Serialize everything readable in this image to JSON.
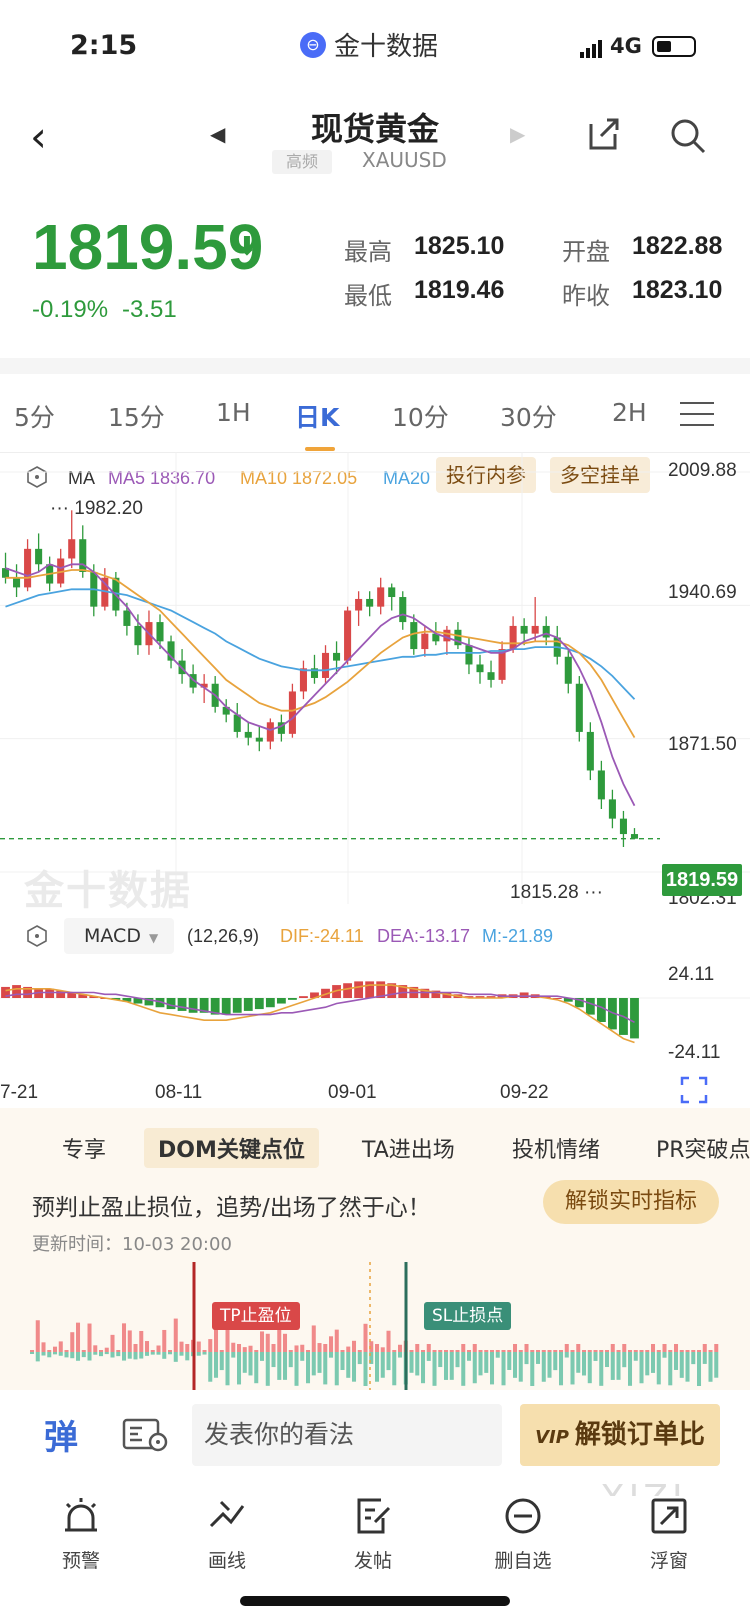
{
  "status": {
    "time": "2:15",
    "app_name": "金十数据",
    "app_logo": "⊖",
    "network": "4G"
  },
  "header": {
    "title": "现货黄金",
    "tag": "高频",
    "ticker": "XAUUSD"
  },
  "quote": {
    "price": "1819.59",
    "change_pct": "-0.19%",
    "change": "-3.51",
    "high_label": "最高",
    "high": "1825.10",
    "open_label": "开盘",
    "open": "1822.88",
    "low_label": "最低",
    "low": "1819.46",
    "prev_label": "昨收",
    "prev": "1823.10",
    "direction": "down",
    "color_down": "#2e9a3c"
  },
  "periods": [
    "5分",
    "15分",
    "1H",
    "日K",
    "10分",
    "30分",
    "2H"
  ],
  "active_period": "日K",
  "ma": {
    "label": "MA",
    "ma5": "MA5 1836.70",
    "ma10": "MA10 1872.05",
    "ma20": "MA20"
  },
  "chips": {
    "a": "投行内参",
    "b": "多空挂单"
  },
  "price_axis": {
    "t1": "2009.88",
    "t2": "1940.69",
    "t3": "1871.50",
    "t4": "1802.31"
  },
  "last_price_tag": "1819.59",
  "annot": {
    "high": "1982.20",
    "low": "1815.28"
  },
  "watermark": "金十数据",
  "macd": {
    "name": "MACD",
    "params": "(12,26,9)",
    "dif": "DIF:-24.11",
    "dea": "DEA:-13.17",
    "m": "M:-21.89",
    "axis_top": "24.11",
    "axis_bottom": "-24.11"
  },
  "dates": [
    "7-21",
    "08-11",
    "09-01",
    "09-22"
  ],
  "strategy_tabs": [
    "专享",
    "DOM关键点位",
    "TA进出场",
    "投机情绪",
    "PR突破点"
  ],
  "strategy": {
    "slogan": "预判止盈止损位，追势/出场了然于心！",
    "unlock": "解锁实时指标",
    "updated": "更新时间：10-03 20:00",
    "tp": "TP止盈位",
    "sl": "SL止损点"
  },
  "input": {
    "qiang": "弹",
    "placeholder": "发表你的看法",
    "vip": "VIP",
    "unlock": "解锁订单比"
  },
  "nav": [
    "预警",
    "画线",
    "发帖",
    "删自选",
    "浮窗"
  ],
  "watermark2": "XIZI",
  "chart_data": {
    "type": "candlestick",
    "title": "现货黄金 XAUUSD 日K",
    "ylim": [
      1802.31,
      2009.88
    ],
    "ticks": [
      "7-21",
      "08-11",
      "09-01",
      "09-22"
    ],
    "ohlc": [
      [
        1960,
        1968,
        1952,
        1955
      ],
      [
        1955,
        1962,
        1945,
        1950
      ],
      [
        1950,
        1975,
        1948,
        1970
      ],
      [
        1970,
        1978,
        1958,
        1962
      ],
      [
        1962,
        1966,
        1948,
        1952
      ],
      [
        1952,
        1970,
        1950,
        1965
      ],
      [
        1965,
        1990,
        1960,
        1975
      ],
      [
        1975,
        1982.2,
        1955,
        1958
      ],
      [
        1958,
        1962,
        1935,
        1940
      ],
      [
        1940,
        1960,
        1938,
        1955
      ],
      [
        1955,
        1958,
        1935,
        1938
      ],
      [
        1938,
        1942,
        1925,
        1930
      ],
      [
        1930,
        1936,
        1915,
        1920
      ],
      [
        1920,
        1938,
        1915,
        1932
      ],
      [
        1932,
        1936,
        1918,
        1922
      ],
      [
        1922,
        1925,
        1908,
        1912
      ],
      [
        1912,
        1918,
        1900,
        1905
      ],
      [
        1905,
        1910,
        1895,
        1898
      ],
      [
        1898,
        1905,
        1890,
        1900
      ],
      [
        1900,
        1904,
        1885,
        1888
      ],
      [
        1888,
        1892,
        1880,
        1884
      ],
      [
        1884,
        1890,
        1872,
        1875
      ],
      [
        1875,
        1880,
        1868,
        1872
      ],
      [
        1872,
        1878,
        1865,
        1870
      ],
      [
        1870,
        1882,
        1866,
        1880
      ],
      [
        1880,
        1884,
        1870,
        1874
      ],
      [
        1874,
        1900,
        1872,
        1896
      ],
      [
        1896,
        1912,
        1892,
        1908
      ],
      [
        1908,
        1915,
        1900,
        1903
      ],
      [
        1903,
        1920,
        1900,
        1916
      ],
      [
        1916,
        1922,
        1905,
        1912
      ],
      [
        1912,
        1940,
        1910,
        1938
      ],
      [
        1938,
        1948,
        1930,
        1944
      ],
      [
        1944,
        1948,
        1935,
        1940
      ],
      [
        1940,
        1955,
        1936,
        1950
      ],
      [
        1950,
        1952,
        1938,
        1945
      ],
      [
        1945,
        1948,
        1928,
        1932
      ],
      [
        1932,
        1936,
        1915,
        1918
      ],
      [
        1918,
        1930,
        1914,
        1926
      ],
      [
        1926,
        1932,
        1920,
        1922
      ],
      [
        1922,
        1930,
        1915,
        1928
      ],
      [
        1928,
        1932,
        1918,
        1920
      ],
      [
        1920,
        1924,
        1905,
        1910
      ],
      [
        1910,
        1915,
        1900,
        1906
      ],
      [
        1906,
        1912,
        1898,
        1902
      ],
      [
        1902,
        1922,
        1900,
        1918
      ],
      [
        1918,
        1935,
        1916,
        1930
      ],
      [
        1930,
        1934,
        1920,
        1926
      ],
      [
        1926,
        1945,
        1922,
        1930
      ],
      [
        1930,
        1935,
        1920,
        1924
      ],
      [
        1924,
        1930,
        1910,
        1914
      ],
      [
        1914,
        1918,
        1895,
        1900
      ],
      [
        1900,
        1904,
        1870,
        1875
      ],
      [
        1875,
        1880,
        1850,
        1855
      ],
      [
        1855,
        1860,
        1835,
        1840
      ],
      [
        1840,
        1845,
        1825,
        1830
      ],
      [
        1830,
        1834,
        1815.28,
        1822
      ],
      [
        1822,
        1825.1,
        1819.46,
        1819.59
      ]
    ],
    "ma5": [
      1960,
      1958,
      1956,
      1958,
      1962,
      1960,
      1962,
      1962,
      1958,
      1952,
      1946,
      1940,
      1932,
      1926,
      1920,
      1914,
      1908,
      1902,
      1898,
      1894,
      1888,
      1884,
      1880,
      1878,
      1876,
      1878,
      1882,
      1888,
      1894,
      1900,
      1906,
      1912,
      1918,
      1924,
      1930,
      1934,
      1936,
      1934,
      1930,
      1926,
      1924,
      1922,
      1920,
      1918,
      1916,
      1916,
      1918,
      1922,
      1924,
      1926,
      1924,
      1918,
      1908,
      1896,
      1880,
      1862,
      1848,
      1836.7
    ],
    "ma10": [
      1955,
      1955,
      1955,
      1956,
      1957,
      1958,
      1959,
      1959,
      1958,
      1956,
      1954,
      1950,
      1946,
      1942,
      1938,
      1932,
      1926,
      1920,
      1914,
      1908,
      1902,
      1898,
      1894,
      1890,
      1888,
      1886,
      1886,
      1888,
      1890,
      1893,
      1897,
      1901,
      1906,
      1911,
      1916,
      1920,
      1924,
      1926,
      1927,
      1927,
      1926,
      1925,
      1924,
      1923,
      1922,
      1921,
      1921,
      1921,
      1922,
      1922,
      1922,
      1920,
      1916,
      1910,
      1902,
      1892,
      1882,
      1872.05
    ],
    "ma20": [
      1940,
      1942,
      1944,
      1946,
      1947,
      1948,
      1949,
      1949,
      1949,
      1948,
      1947,
      1946,
      1944,
      1942,
      1940,
      1938,
      1935,
      1932,
      1929,
      1926,
      1922,
      1919,
      1916,
      1913,
      1911,
      1909,
      1908,
      1907,
      1907,
      1907,
      1908,
      1909,
      1910,
      1911,
      1912,
      1913,
      1914,
      1914,
      1915,
      1915,
      1916,
      1916,
      1916,
      1916,
      1917,
      1917,
      1918,
      1918,
      1919,
      1919,
      1919,
      1918,
      1916,
      1913,
      1909,
      1904,
      1898,
      1892
    ],
    "macd_hist": [
      6,
      7,
      6,
      5,
      5,
      4,
      3,
      2,
      1,
      0,
      -1,
      -2,
      -3,
      -4,
      -5,
      -6,
      -7,
      -8,
      -8,
      -9,
      -9,
      -8,
      -7,
      -6,
      -5,
      -3,
      -1,
      1,
      3,
      5,
      7,
      8,
      9,
      9,
      9,
      8,
      7,
      6,
      5,
      4,
      3,
      2,
      1,
      1,
      1,
      2,
      2,
      3,
      2,
      1,
      0,
      -2,
      -5,
      -9,
      -13,
      -17,
      -20,
      -21.89
    ],
    "dif": [
      4,
      5,
      5,
      5,
      5,
      4,
      3,
      2,
      1,
      0,
      -1,
      -2,
      -4,
      -6,
      -8,
      -9,
      -10,
      -11,
      -12,
      -12,
      -12,
      -11,
      -10,
      -9,
      -8,
      -6,
      -4,
      -2,
      0,
      2,
      4,
      5,
      6,
      7,
      7,
      7,
      6,
      5,
      4,
      3,
      2,
      1,
      0,
      0,
      0,
      0,
      1,
      1,
      1,
      0,
      -1,
      -3,
      -6,
      -10,
      -14,
      -18,
      -22,
      -24.11
    ],
    "dea": [
      1,
      2,
      2,
      3,
      3,
      3,
      3,
      3,
      3,
      2,
      2,
      1,
      0,
      -1,
      -2,
      -4,
      -5,
      -6,
      -7,
      -8,
      -9,
      -9,
      -9,
      -9,
      -9,
      -8,
      -8,
      -7,
      -6,
      -5,
      -3,
      -2,
      -1,
      0,
      1,
      2,
      3,
      3,
      3,
      3,
      3,
      3,
      2,
      2,
      2,
      1,
      1,
      1,
      1,
      1,
      1,
      0,
      -1,
      -3,
      -5,
      -8,
      -10,
      -13.17
    ],
    "strategy_bars_count": 120
  }
}
